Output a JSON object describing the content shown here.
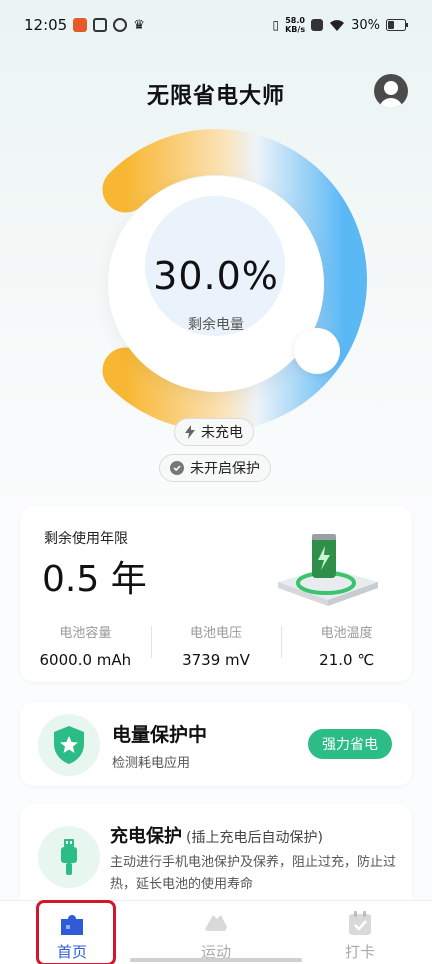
{
  "status_bar": {
    "time": "12:05",
    "net_speed_value": "58.0",
    "net_speed_unit": "KB/s",
    "battery_text": "30%"
  },
  "header": {
    "title": "无限省电大师"
  },
  "gauge": {
    "percent_text": "30.0%",
    "label": "剩余电量",
    "level_fraction": 0.3
  },
  "chips": {
    "charging": "未充电",
    "protection": "未开启保护"
  },
  "battery_card": {
    "life_label": "剩余使用年限",
    "life_value": "0.5 年",
    "stats": [
      {
        "label": "电池容量",
        "value": "6000.0 mAh"
      },
      {
        "label": "电池电压",
        "value": "3739 mV"
      },
      {
        "label": "电池温度",
        "value": "21.0 ℃"
      }
    ]
  },
  "protect_card": {
    "title": "电量保护中",
    "subtitle": "检测耗电应用",
    "button": "强力省电"
  },
  "charge_card": {
    "title": "充电保护",
    "title_note": "(插上充电后自动保护)",
    "description": "主动进行手机电池保护及保养，阻止过充，防止过热，延长电池的使用寿命"
  },
  "tabbar": {
    "tabs": [
      {
        "label": "首页",
        "icon": "home-puzzle-icon",
        "active": true
      },
      {
        "label": "运动",
        "icon": "sneaker-icon",
        "active": false
      },
      {
        "label": "打卡",
        "icon": "calendar-check-icon",
        "active": false
      }
    ]
  },
  "colors": {
    "accent_green": "#2bbd85",
    "tab_active": "#2f5bd8",
    "gauge_start": "#f7b733",
    "gauge_end": "#5ab8f5"
  }
}
